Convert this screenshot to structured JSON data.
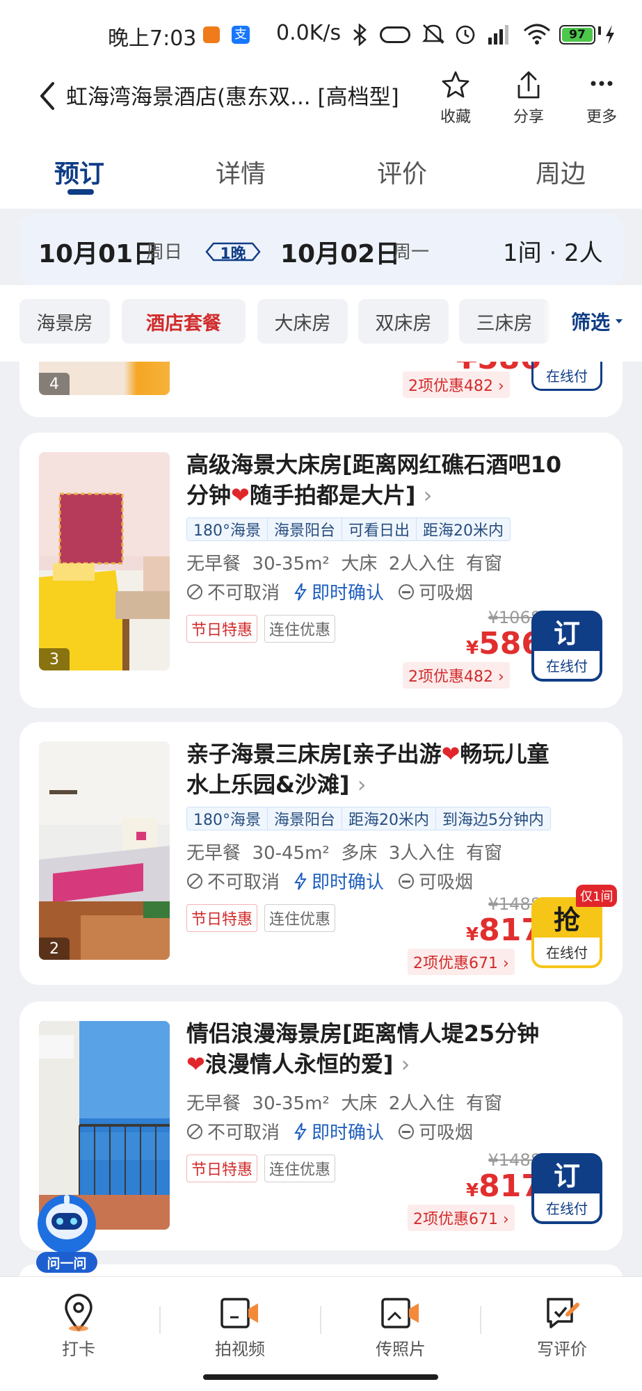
{
  "status_bar": {
    "time": "晚上7:03",
    "network_speed": "0.0K/s",
    "battery": "97"
  },
  "header": {
    "title": "虹海湾海景酒店(惠东双... [高档型]",
    "actions": [
      {
        "label": "收藏",
        "icon": "star-icon"
      },
      {
        "label": "分享",
        "icon": "share-icon"
      },
      {
        "label": "更多",
        "icon": "more-icon"
      }
    ]
  },
  "tabs": [
    {
      "label": "预订",
      "active": true
    },
    {
      "label": "详情",
      "active": false
    },
    {
      "label": "评价",
      "active": false
    },
    {
      "label": "周边",
      "active": false
    }
  ],
  "date_bar": {
    "checkin_date": "10月01日",
    "checkin_weekday": "周日",
    "nights": "1晚",
    "checkout_date": "10月02日",
    "checkout_weekday": "周一",
    "rooms_guests": "1间 · 2人"
  },
  "filters": [
    {
      "label": "海景房",
      "highlight": false
    },
    {
      "label": "酒店套餐",
      "highlight": true
    },
    {
      "label": "大床房",
      "highlight": false
    },
    {
      "label": "双床房",
      "highlight": false
    },
    {
      "label": "三床房",
      "highlight": false
    }
  ],
  "filter_button": "筛选",
  "partial_card": {
    "photo_count": "4",
    "price_fragment": "¥586",
    "discount": "2项优惠482",
    "book_sub": "在线付"
  },
  "rooms": [
    {
      "title": "高级海景大床房[距离网红礁石酒吧10分钟❤️随手拍都是大片]",
      "title_line1": "高级海景大床房[距离网红礁石酒吧10",
      "title_line2a": "分钟",
      "title_line2b": "随手拍都是大片]",
      "tags": [
        "180°海景",
        "海景阳台",
        "可看日出",
        "距海20米内"
      ],
      "desc": "无早餐  30-35m²  大床  2人入住  有窗",
      "policy_cancel": "不可取消",
      "policy_confirm": "即时确认",
      "policy_smoke": "可吸烟",
      "promos": [
        "节日特惠",
        "连住优惠"
      ],
      "original_price": "¥1068",
      "currency": "¥",
      "price": "586",
      "discount": "2项优惠482",
      "book_main": "订",
      "book_sub": "在线付",
      "photo_count": "3",
      "accent": "#0f3d86"
    },
    {
      "title": "亲子海景三床房[亲子出游❤️畅玩儿童水上乐园&沙滩]",
      "title_line1a": "亲子海景三床房[亲子出游",
      "title_line1b": "畅玩儿童",
      "title_line2": "水上乐园&沙滩]",
      "tags": [
        "180°海景",
        "海景阳台",
        "距海20米内",
        "到海边5分钟内"
      ],
      "desc": "无早餐  30-45m²  多床  3人入住  有窗",
      "policy_cancel": "不可取消",
      "policy_confirm": "即时确认",
      "policy_smoke": "可吸烟",
      "promos": [
        "节日特惠",
        "连住优惠"
      ],
      "original_price": "¥1488",
      "currency": "¥",
      "price": "817",
      "discount": "2项优惠671",
      "book_main": "抢",
      "book_sub": "在线付",
      "badge": "仅1间",
      "photo_count": "2",
      "accent": "#f5c518"
    },
    {
      "title": "情侣浪漫海景房[距离情人堤25分钟❤️浪漫情人永恒的爱]",
      "title_line1": "情侣浪漫海景房[距离情人堤25分钟",
      "title_line2": "浪漫情人永恒的爱]",
      "desc": "无早餐  30-35m²  大床  2人入住  有窗",
      "policy_cancel": "不可取消",
      "policy_confirm": "即时确认",
      "policy_smoke": "可吸烟",
      "promos": [
        "节日特惠",
        "连住优惠"
      ],
      "original_price": "¥1488",
      "currency": "¥",
      "price": "817",
      "discount": "2项优惠671",
      "book_main": "订",
      "book_sub": "在线付",
      "accent": "#0f3d86"
    }
  ],
  "assistant": {
    "label": "问一问"
  },
  "bottom_nav": [
    {
      "label": "打卡",
      "icon": "location-pin-icon"
    },
    {
      "label": "拍视频",
      "icon": "video-icon"
    },
    {
      "label": "传照片",
      "icon": "photo-upload-icon"
    },
    {
      "label": "写评价",
      "icon": "write-review-icon"
    }
  ]
}
